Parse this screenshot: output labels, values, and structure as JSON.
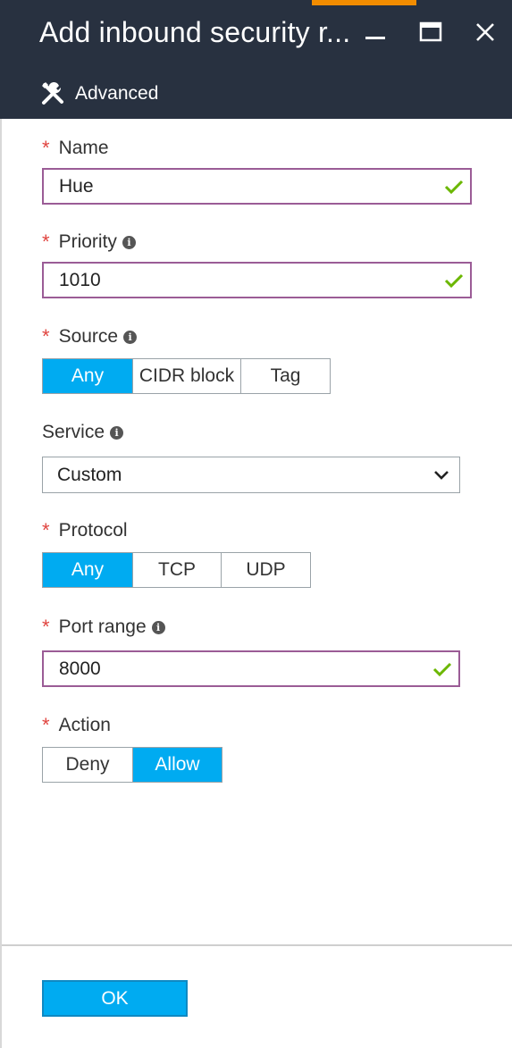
{
  "window": {
    "title": "Add inbound security r...",
    "command": {
      "label": "Advanced",
      "icon": "tools-icon"
    },
    "controls": [
      "minimize-icon",
      "maximize-icon",
      "close-icon"
    ]
  },
  "form": {
    "name": {
      "label": "Name",
      "required": true,
      "value": "Hue",
      "valid": true
    },
    "priority": {
      "label": "Priority",
      "required": true,
      "info": true,
      "value": "1010",
      "valid": true
    },
    "source": {
      "label": "Source",
      "required": true,
      "info": true,
      "options": [
        "Any",
        "CIDR block",
        "Tag"
      ],
      "selected": "Any"
    },
    "service": {
      "label": "Service",
      "info": true,
      "value": "Custom"
    },
    "protocol": {
      "label": "Protocol",
      "required": true,
      "options": [
        "Any",
        "TCP",
        "UDP"
      ],
      "selected": "Any"
    },
    "port_range": {
      "label": "Port range",
      "required": true,
      "info": true,
      "value": "8000",
      "valid": true
    },
    "action": {
      "label": "Action",
      "required": true,
      "options": [
        "Deny",
        "Allow"
      ],
      "selected": "Allow"
    }
  },
  "footer": {
    "ok_label": "OK"
  },
  "symbols": {
    "required_mark": "*",
    "info_mark": "i"
  },
  "colors": {
    "header_bg": "#283140",
    "accent": "#00abf1",
    "valid_border": "#9b5c96",
    "check": "#6bb700",
    "required": "#e0443f",
    "top_accent": "#f28c00"
  }
}
